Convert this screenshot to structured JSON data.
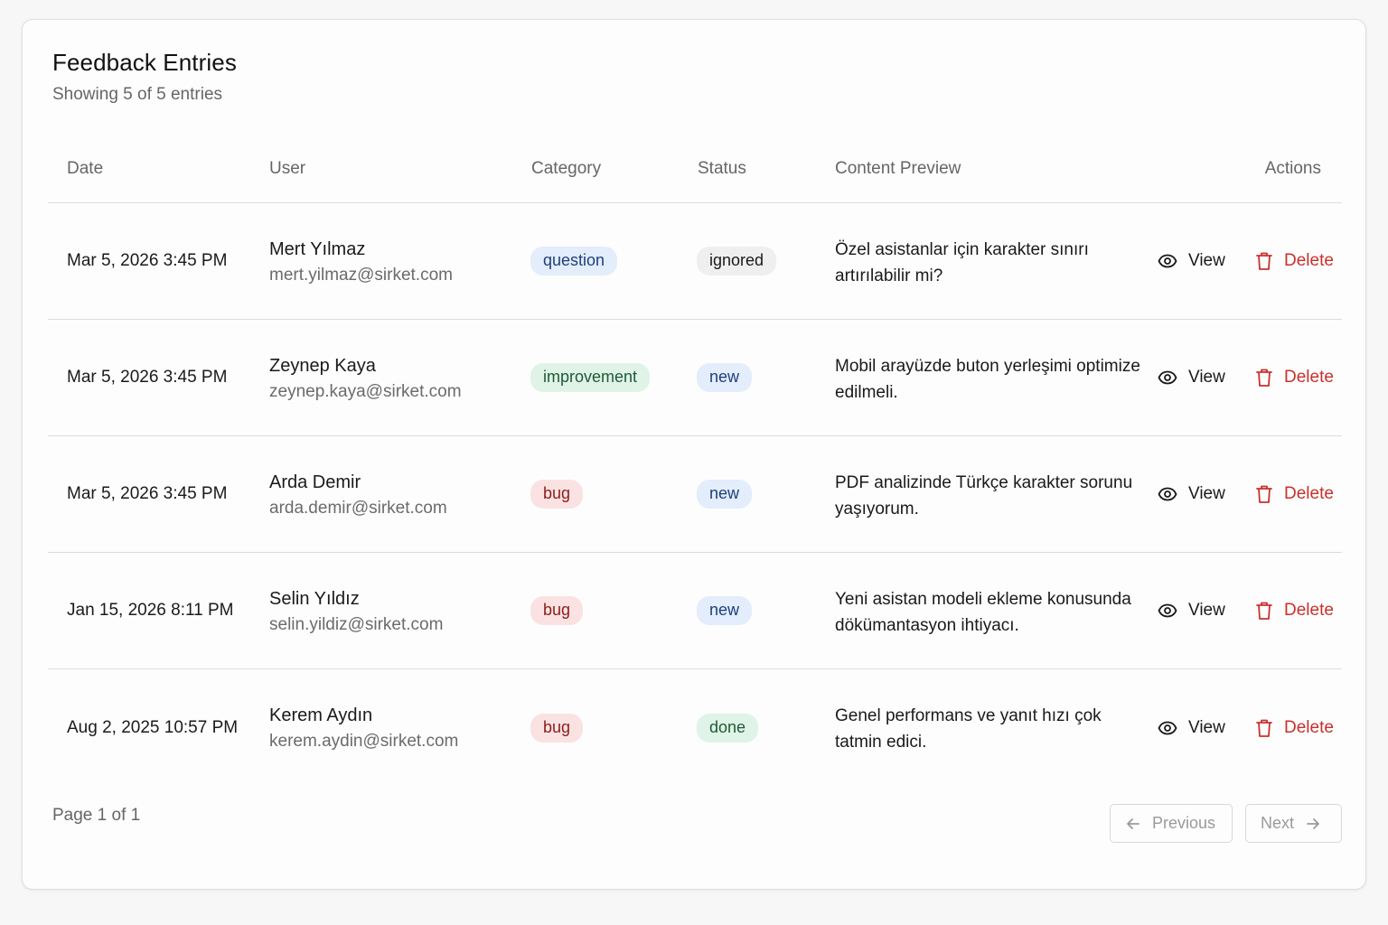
{
  "header": {
    "title": "Feedback Entries",
    "subtitle": "Showing 5 of 5 entries"
  },
  "table": {
    "columns": {
      "date": "Date",
      "user": "User",
      "category": "Category",
      "status": "Status",
      "content": "Content Preview",
      "actions": "Actions"
    },
    "view_label": "View",
    "delete_label": "Delete",
    "rows": [
      {
        "date": "Mar 5, 2026 3:45 PM",
        "name": "Mert Yılmaz",
        "email": "mert.yilmaz@sirket.com",
        "category": "question",
        "status": "ignored",
        "content": "Özel asistanlar için karakter sınırı artırılabilir mi?"
      },
      {
        "date": "Mar 5, 2026 3:45 PM",
        "name": "Zeynep Kaya",
        "email": "zeynep.kaya@sirket.com",
        "category": "improvement",
        "status": "new",
        "content": "Mobil arayüzde buton yerleşimi optimize edilmeli."
      },
      {
        "date": "Mar 5, 2026 3:45 PM",
        "name": "Arda Demir",
        "email": "arda.demir@sirket.com",
        "category": "bug",
        "status": "new",
        "content": "PDF analizinde Türkçe karakter sorunu yaşıyorum."
      },
      {
        "date": "Jan 15, 2026 8:11 PM",
        "name": "Selin Yıldız",
        "email": "selin.yildiz@sirket.com",
        "category": "bug",
        "status": "new",
        "content": "Yeni asistan modeli ekleme konusunda dökümantasyon ihtiyacı."
      },
      {
        "date": "Aug 2, 2025 10:57 PM",
        "name": "Kerem Aydın",
        "email": "kerem.aydin@sirket.com",
        "category": "bug",
        "status": "done",
        "content": "Genel performans ve yanıt hızı çok tatmin edici."
      }
    ]
  },
  "badge_styles": {
    "question": {
      "bg": "#e3edfb",
      "fg": "#1f3f7a"
    },
    "improvement": {
      "bg": "#e0f3e7",
      "fg": "#1e5a36"
    },
    "bug": {
      "bg": "#fbe2e2",
      "fg": "#8a1c1c"
    },
    "ignored": {
      "bg": "#efefef",
      "fg": "#1a1a1a"
    },
    "new": {
      "bg": "#e3edfb",
      "fg": "#1f3f7a"
    },
    "done": {
      "bg": "#e0f3e7",
      "fg": "#1e5a36"
    }
  },
  "icons": {
    "view": "eye-icon",
    "delete": "trash-icon",
    "previous": "arrow-left-icon",
    "next": "arrow-right-icon"
  },
  "pagination": {
    "info": "Page 1 of 1",
    "previous_label": "Previous",
    "next_label": "Next"
  }
}
